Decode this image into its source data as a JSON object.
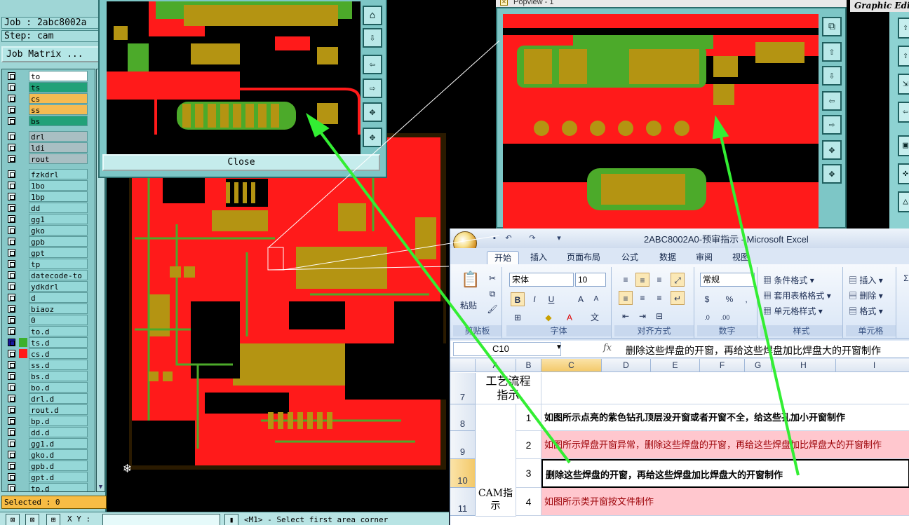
{
  "job_info": {
    "job_line": "Job : 2abc8002a",
    "step_line": "Step: cam",
    "job_matrix_label": "Job Matrix ..."
  },
  "layers": [
    {
      "name": "to",
      "color": "white"
    },
    {
      "name": "ts",
      "color": "green"
    },
    {
      "name": "cs",
      "color": "orange"
    },
    {
      "name": "ss",
      "color": "orange"
    },
    {
      "name": "bs",
      "color": "green"
    },
    {
      "name": "drl",
      "color": "gray"
    },
    {
      "name": "ldi",
      "color": "gray"
    },
    {
      "name": "rout",
      "color": "gray"
    },
    {
      "name": "fzkdrl",
      "color": "cyan"
    },
    {
      "name": "1bo",
      "color": "cyan"
    },
    {
      "name": "1bp",
      "color": "cyan"
    },
    {
      "name": "dd",
      "color": "cyan"
    },
    {
      "name": "gg1",
      "color": "cyan"
    },
    {
      "name": "gko",
      "color": "cyan"
    },
    {
      "name": "gpb",
      "color": "cyan"
    },
    {
      "name": "gpt",
      "color": "cyan"
    },
    {
      "name": "tp",
      "color": "cyan"
    },
    {
      "name": "datecode-to",
      "color": "cyan"
    },
    {
      "name": "ydkdrl",
      "color": "cyan"
    },
    {
      "name": "d",
      "color": "cyan"
    },
    {
      "name": "biaoz",
      "color": "cyan"
    },
    {
      "name": "0",
      "color": "cyan"
    },
    {
      "name": "to.d",
      "color": "cyan"
    },
    {
      "name": "ts.d",
      "color": "cyan"
    },
    {
      "name": "cs.d",
      "color": "cyan"
    },
    {
      "name": "ss.d",
      "color": "cyan"
    },
    {
      "name": "bs.d",
      "color": "cyan"
    },
    {
      "name": "bo.d",
      "color": "cyan"
    },
    {
      "name": "drl.d",
      "color": "cyan"
    },
    {
      "name": "rout.d",
      "color": "cyan"
    },
    {
      "name": "bp.d",
      "color": "cyan"
    },
    {
      "name": "dd.d",
      "color": "cyan"
    },
    {
      "name": "gg1.d",
      "color": "cyan"
    },
    {
      "name": "gko.d",
      "color": "cyan"
    },
    {
      "name": "gpb.d",
      "color": "cyan"
    },
    {
      "name": "gpt.d",
      "color": "cyan"
    },
    {
      "name": "tp.d",
      "color": "cyan"
    }
  ],
  "selected_label": "Selected : 0",
  "status": {
    "xy_label": "X Y :",
    "prompt": "<M1> - Select first area corner"
  },
  "popview1": {
    "close_label": "Close"
  },
  "popview2": {
    "title": "Popview - 1"
  },
  "graphic_editor": {
    "title": "Graphic Edito"
  },
  "excel": {
    "title": "2ABC8002A0-预审指示 - Microsoft Excel",
    "tabs": [
      "开始",
      "插入",
      "页面布局",
      "公式",
      "数据",
      "审阅",
      "视图"
    ],
    "active_tab": "开始",
    "clipboard": {
      "paste_label": "粘贴",
      "group_label": "剪贴板"
    },
    "font": {
      "name": "宋体",
      "size": "10",
      "group_label": "字体"
    },
    "alignment": {
      "group_label": "对齐方式"
    },
    "number": {
      "format": "常规",
      "group_label": "数字"
    },
    "styles": {
      "conditional": "条件格式",
      "table": "套用表格格式",
      "cell_styles": "单元格样式",
      "group_label": "样式"
    },
    "cells": {
      "insert": "插入",
      "delete": "删除",
      "format": "格式",
      "group_label": "单元格"
    },
    "name_box": "C10",
    "formula": "删除这些焊盘的开窗，再给这些焊盘加比焊盘大的开窗制作",
    "columns": [
      "A",
      "B",
      "C",
      "D",
      "E",
      "F",
      "G",
      "H",
      "I"
    ],
    "rows": [
      {
        "num": "7",
        "a": "工艺流程指示",
        "b": "",
        "c": "",
        "style": "plain"
      },
      {
        "num": "8",
        "a": "",
        "b": "1",
        "c": "如图所示点亮的紫色钻孔顶层没开窗或者开窗不全，给这些孔加小开窗制作",
        "style": "bold"
      },
      {
        "num": "9",
        "a": "",
        "b": "2",
        "c": "如图所示焊盘开窗异常，删除这些焊盘的开窗，再给这些焊盘加比焊盘大的开窗制作",
        "style": "pink"
      },
      {
        "num": "10",
        "a": "",
        "b": "3",
        "c": "删除这些焊盘的开窗，再给这些焊盘加比焊盘大的开窗制作",
        "style": "bold"
      },
      {
        "num": "11",
        "a": "",
        "b": "4",
        "c": "如图所示类开窗按文件制作",
        "style": "pink"
      }
    ],
    "merged_a_label": "CAM指示"
  },
  "colors": {
    "panel_cyan": "#9fd6d6",
    "copper_red": "#ff1a1a",
    "pad_olive": "#b49412",
    "mask_green": "#4caa2a",
    "arrow_green": "#33ee33"
  }
}
